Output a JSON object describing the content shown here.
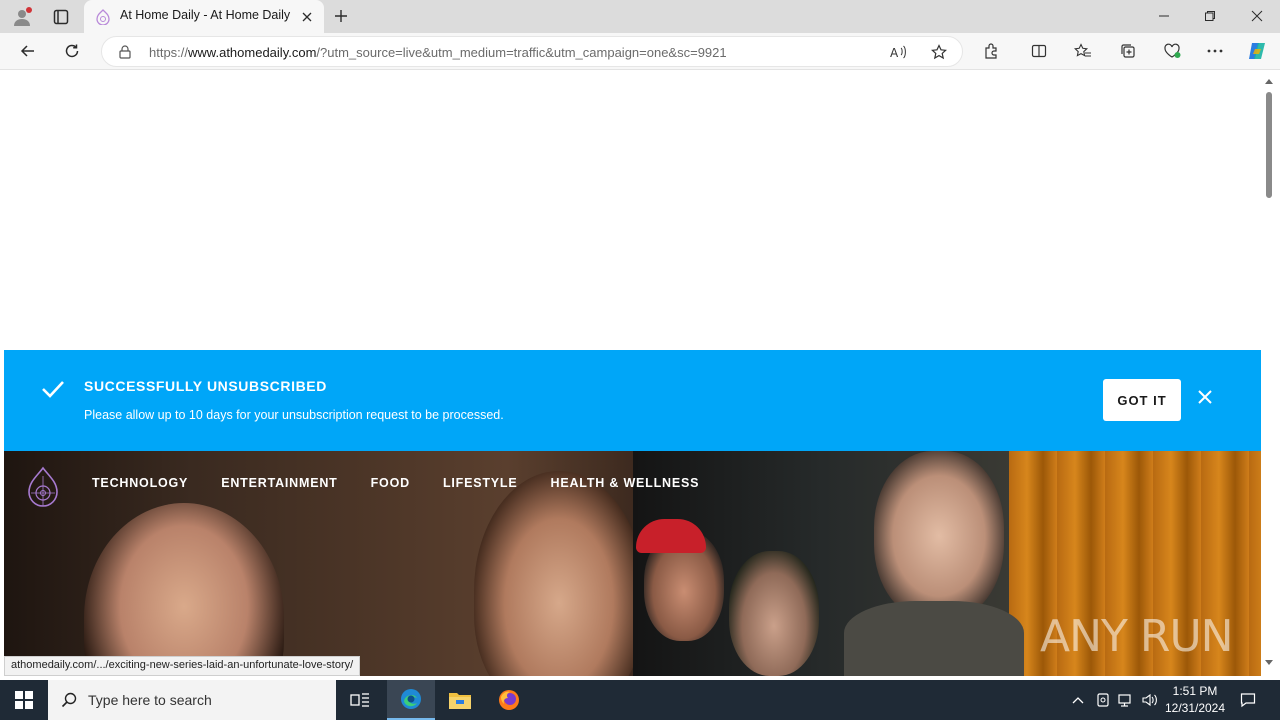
{
  "browser": {
    "tab_title": "At Home Daily - At Home Daily",
    "url_prefix": "https://",
    "url_host": "www.athomedaily.com",
    "url_rest": "/?utm_source=live&utm_medium=traffic&utm_campaign=one&sc=9921"
  },
  "banner": {
    "title": "SUCCESSFULLY UNSUBSCRIBED",
    "message": "Please allow up to 10 days for your unsubscription request to be processed.",
    "button_label": "GOT IT",
    "color": "#00a6f8"
  },
  "nav": {
    "items": [
      "TECHNOLOGY",
      "ENTERTAINMENT",
      "FOOD",
      "LIFESTYLE",
      "HEALTH & WELLNESS"
    ]
  },
  "hero": {
    "watermark": "ANY RUN"
  },
  "status_link": "athomedaily.com/.../exciting-new-series-laid-an-unfortunate-love-story/",
  "taskbar": {
    "search_placeholder": "Type here to search",
    "time": "1:51 PM",
    "date": "12/31/2024"
  }
}
